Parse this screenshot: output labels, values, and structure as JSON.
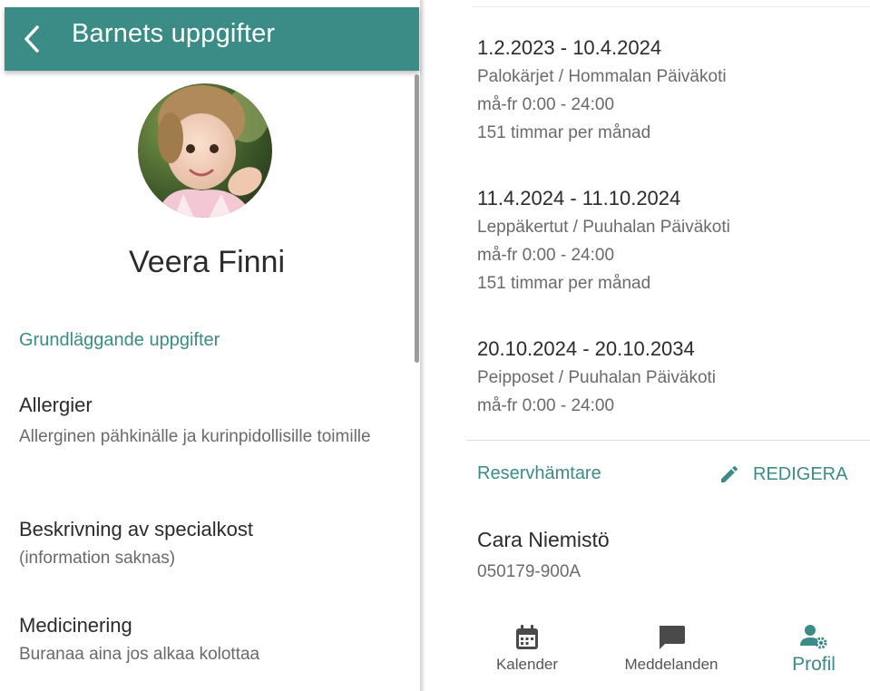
{
  "header": {
    "title": "Barnets uppgifter"
  },
  "child": {
    "name": "Veera Finni"
  },
  "basic": {
    "section_title": "Grundläggande uppgifter",
    "fields": [
      {
        "label": "Allergier",
        "value": "Allerginen pähkinälle ja kurinpidollisille toimille"
      },
      {
        "label": "Beskrivning av specialkost",
        "value": "(information saknas)"
      },
      {
        "label": "Medicinering",
        "value": "Buranaa aina jos alkaa kolottaa"
      }
    ]
  },
  "placements": [
    {
      "dates": "1.2.2023 - 10.4.2024",
      "unit": "Palokärjet / Hommalan Päiväkoti",
      "schedule": "må-fr 0:00 - 24:00",
      "hours": "151 timmar per månad"
    },
    {
      "dates": "11.4.2024 - 11.10.2024",
      "unit": "Leppäkertut / Puuhalan Päiväkoti",
      "schedule": "må-fr 0:00 - 24:00",
      "hours": "151 timmar per månad"
    },
    {
      "dates": "20.10.2024 - 20.10.2034",
      "unit": "Peipposet / Puuhalan Päiväkoti",
      "schedule": "må-fr 0:00 - 24:00"
    }
  ],
  "backup_pickup": {
    "section_title": "Reservhämtare",
    "edit_label": "REDIGERA",
    "name": "Cara Niemistö",
    "id": "050179-900A"
  },
  "nav": {
    "items": [
      {
        "label": "Kalender",
        "icon": "calendar-icon"
      },
      {
        "label": "Meddelanden",
        "icon": "chat-icon"
      },
      {
        "label": "Profil",
        "icon": "profile-gear-icon",
        "active": true
      }
    ]
  },
  "colors": {
    "accent": "#3b8b86",
    "text": "#2b2b2b",
    "secondary_text": "#6a6a6a"
  }
}
